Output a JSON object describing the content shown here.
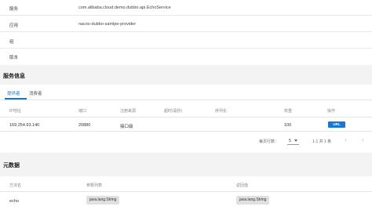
{
  "basic": {
    "rows": [
      {
        "key": "服务",
        "value": "com.alibaba.cloud.demo.dubbo.api.EchoService"
      },
      {
        "key": "应用",
        "value": "nacos-dubbo-samlpe-provider"
      },
      {
        "key": "组",
        "value": ""
      },
      {
        "key": "版本",
        "value": ""
      }
    ]
  },
  "service_info": {
    "title": "服务信息",
    "tabs": [
      {
        "label": "提供者",
        "active": true
      },
      {
        "label": "消费者",
        "active": false
      }
    ],
    "columns": [
      "IP地址",
      "端口",
      "注册来源",
      "超时(毫秒)",
      "序列化",
      "权重",
      "操作"
    ],
    "rows": [
      {
        "ip": "169.254.93.140",
        "port": "20880",
        "source": "接口级",
        "timeout": "",
        "serialization": "",
        "weight": "100",
        "action": "URL"
      }
    ],
    "pagination": {
      "rows_per_page_label": "每页行数：",
      "rows_per_page": "5",
      "range": "1-1 共 1 条"
    }
  },
  "metadata": {
    "title": "元数据",
    "columns": [
      "方法名",
      "参数列表",
      "返回值"
    ],
    "rows": [
      {
        "method": "echo",
        "params": "java.lang.String",
        "returns": "java.lang.String"
      }
    ]
  },
  "colors": {
    "accent": "#1976d2"
  },
  "icons": {
    "prev": "chevron-left-icon",
    "next": "chevron-right-icon",
    "caret": "caret-down-icon"
  }
}
